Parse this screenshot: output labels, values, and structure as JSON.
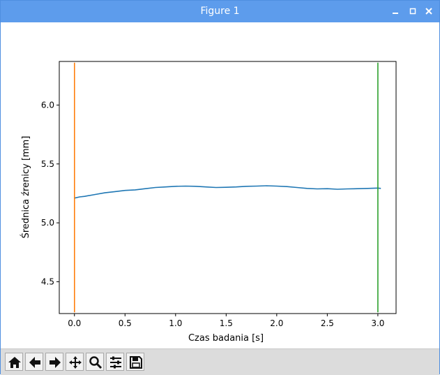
{
  "window": {
    "title": "Figure 1",
    "controls": [
      "minimize",
      "maximize",
      "close"
    ],
    "accent": "#5d9cec"
  },
  "toolbar": {
    "buttons": [
      {
        "name": "home-icon",
        "action": "home"
      },
      {
        "name": "arrow-left-icon",
        "action": "back"
      },
      {
        "name": "arrow-right-icon",
        "action": "forward"
      },
      {
        "name": "pan-icon",
        "action": "pan"
      },
      {
        "name": "zoom-icon",
        "action": "zoom"
      },
      {
        "name": "sliders-icon",
        "action": "configure subplots"
      },
      {
        "name": "save-icon",
        "action": "save"
      }
    ]
  },
  "chart_data": {
    "type": "line",
    "xlabel": "Czas badania [s]",
    "ylabel": "Średnica źrenicy [mm]",
    "xlim": [
      -0.15,
      3.18
    ],
    "ylim": [
      4.23,
      6.37
    ],
    "xticks": [
      0.0,
      0.5,
      1.0,
      1.5,
      2.0,
      2.5,
      3.0
    ],
    "xtick_labels": [
      "0.0",
      "0.5",
      "1.0",
      "1.5",
      "2.0",
      "2.5",
      "3.0"
    ],
    "yticks": [
      4.5,
      5.0,
      5.5,
      6.0
    ],
    "ytick_labels": [
      "4.5",
      "5.0",
      "5.5",
      "6.0"
    ],
    "grid": false,
    "series": [
      {
        "color": "#1f77b4",
        "x": [
          0.0,
          0.05,
          0.1,
          0.2,
          0.3,
          0.4,
          0.5,
          0.6,
          0.7,
          0.8,
          0.9,
          1.0,
          1.1,
          1.2,
          1.3,
          1.4,
          1.5,
          1.6,
          1.7,
          1.8,
          1.9,
          2.0,
          2.1,
          2.2,
          2.3,
          2.4,
          2.5,
          2.6,
          2.7,
          2.8,
          2.9,
          3.0,
          3.03
        ],
        "y": [
          5.21,
          5.22,
          5.225,
          5.24,
          5.255,
          5.265,
          5.275,
          5.28,
          5.29,
          5.3,
          5.305,
          5.31,
          5.312,
          5.31,
          5.305,
          5.3,
          5.302,
          5.305,
          5.31,
          5.312,
          5.315,
          5.312,
          5.308,
          5.3,
          5.292,
          5.288,
          5.29,
          5.285,
          5.288,
          5.29,
          5.292,
          5.295,
          5.292
        ]
      },
      {
        "color": "#ff7f0e",
        "x": [
          0.0,
          0.0
        ],
        "y": [
          4.24,
          6.36
        ]
      },
      {
        "color": "#2ca02c",
        "x": [
          3.0,
          3.0
        ],
        "y": [
          4.24,
          6.36
        ]
      }
    ]
  }
}
